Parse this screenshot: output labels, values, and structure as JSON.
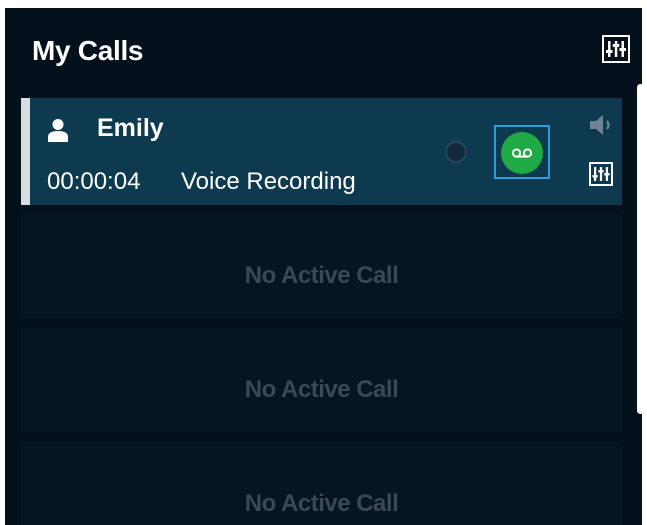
{
  "header": {
    "title": "My Calls",
    "settings_icon": "equalizer-icon"
  },
  "active_call": {
    "caller_name": "Emily",
    "duration": "00:00:04",
    "status": "Voice Recording",
    "caller_icon": "person-icon",
    "voicemail_icon": "voicemail-icon",
    "speaker_icon": "speaker-icon",
    "audio_settings_icon": "equalizer-icon",
    "accent_color": "#0e3a50",
    "voicemail_color": "#1faa45",
    "focus_color": "#2f9bd8"
  },
  "empty_slots": [
    {
      "label": "No Active Call"
    },
    {
      "label": "No Active Call"
    },
    {
      "label": "No Active Call"
    }
  ],
  "colors": {
    "background": "#04111c",
    "empty_text": "#3b4954"
  }
}
